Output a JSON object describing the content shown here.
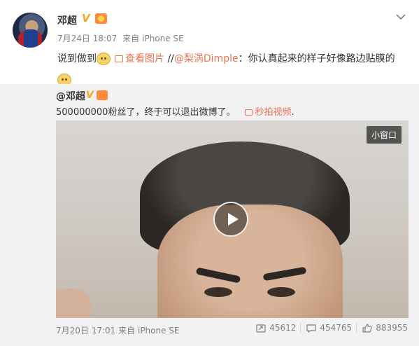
{
  "post": {
    "username": "邓超",
    "time": "7月24日 18:07",
    "source_prefix": "来自",
    "source": "iPhone SE",
    "text_start": "说到做到",
    "view_image_label": "查看图片",
    "sep": "//",
    "mention": "@梨涡Dimple",
    "text_end": "：你认真起来的样子好像路边贴膜的"
  },
  "repost": {
    "username": "@邓超",
    "text": "500000000粉丝了，终于可以退出微博了。",
    "video_label": "秒拍视频",
    "trailing": ".",
    "mini_window": "小窗口",
    "time": "7月20日 17:01",
    "source_prefix": "来自",
    "source": "iPhone SE",
    "reposts": "45612",
    "comments": "454765",
    "likes": "883955"
  },
  "icons": {
    "verified": "verified-v-icon",
    "medal": "member-medal-icon",
    "menu": "chevron-down-icon",
    "play": "play-icon",
    "repost": "repost-icon",
    "comment": "comment-icon",
    "like": "like-icon"
  },
  "colors": {
    "link": "#eb7350",
    "verified": "#f5a623",
    "meta": "#808080",
    "repost_bg": "#f2f2f5"
  }
}
